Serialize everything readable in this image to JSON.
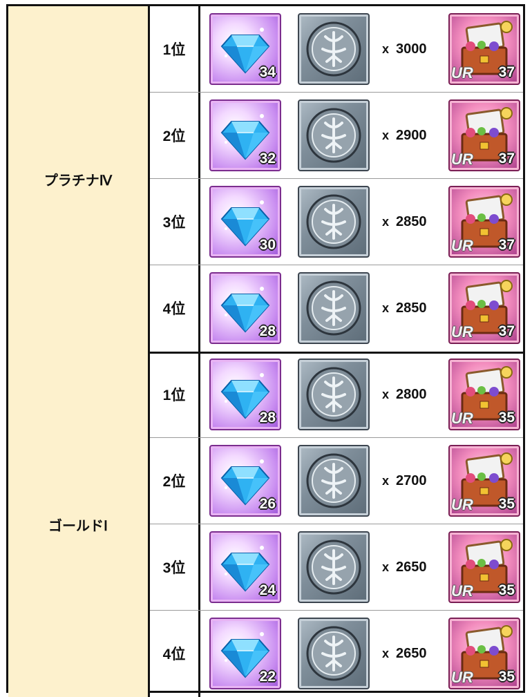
{
  "colors": {
    "label_bg": "#fdf1cd",
    "border": "#111111"
  },
  "groups": [
    {
      "label": "プラチナⅣ",
      "rows": [
        {
          "rank": "1位",
          "gem_count": "34",
          "quantity": "3000",
          "chest_badge": "UR",
          "chest_count": "37"
        },
        {
          "rank": "2位",
          "gem_count": "32",
          "quantity": "2900",
          "chest_badge": "UR",
          "chest_count": "37"
        },
        {
          "rank": "3位",
          "gem_count": "30",
          "quantity": "2850",
          "chest_badge": "UR",
          "chest_count": "37"
        },
        {
          "rank": "4位",
          "gem_count": "28",
          "quantity": "2850",
          "chest_badge": "UR",
          "chest_count": "37"
        }
      ]
    },
    {
      "label": "ゴールドⅠ",
      "rows": [
        {
          "rank": "1位",
          "gem_count": "28",
          "quantity": "2800",
          "chest_badge": "UR",
          "chest_count": "35"
        },
        {
          "rank": "2位",
          "gem_count": "26",
          "quantity": "2700",
          "chest_badge": "UR",
          "chest_count": "35"
        },
        {
          "rank": "3位",
          "gem_count": "24",
          "quantity": "2650",
          "chest_badge": "UR",
          "chest_count": "35"
        },
        {
          "rank": "4位",
          "gem_count": "22",
          "quantity": "2650",
          "chest_badge": "UR",
          "chest_count": "35"
        }
      ]
    }
  ],
  "icons": {
    "gem": "blue-gem-icon",
    "medal": "silver-medal-icon",
    "chest": "treasure-chest-icon"
  },
  "multiply_sign": "x"
}
